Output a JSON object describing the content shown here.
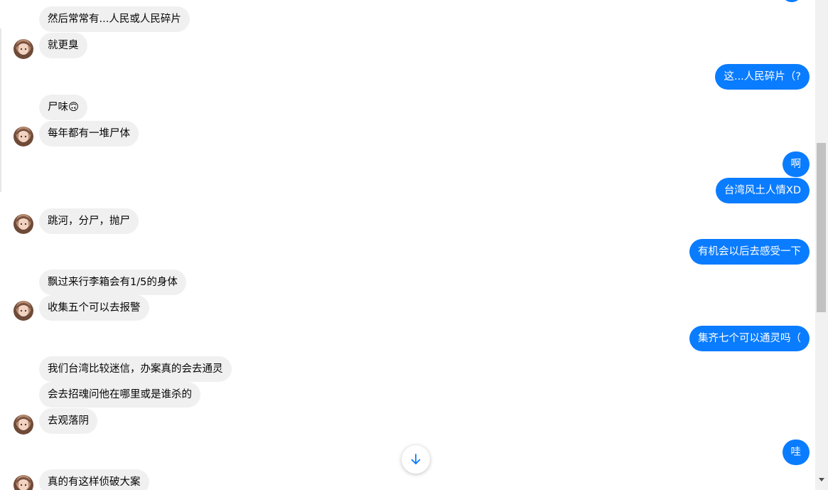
{
  "colors": {
    "outgoing_bubble": "#0a7cff",
    "incoming_bubble": "#f0f0f0",
    "accent_icon": "#0a7cff"
  },
  "messages": [
    {
      "side": "in",
      "text": "然后常常有...人民或人民碎片"
    },
    {
      "side": "in",
      "text": "就更臭",
      "avatar": true
    },
    {
      "side": "out",
      "text": "这...人民碎片（?"
    },
    {
      "side": "in",
      "text": "尸味🙃"
    },
    {
      "side": "in",
      "text": "每年都有一堆尸体",
      "avatar": true
    },
    {
      "side": "out",
      "text": "啊"
    },
    {
      "side": "out",
      "text": "台湾风土人情XD"
    },
    {
      "side": "in",
      "text": "跳河，分尸，抛尸",
      "avatar": true
    },
    {
      "side": "out",
      "text": "有机会以后去感受一下"
    },
    {
      "side": "in",
      "text": "飘过来行李箱会有1/5的身体"
    },
    {
      "side": "in",
      "text": "收集五个可以去报警",
      "avatar": true
    },
    {
      "side": "out",
      "text": "集齐七个可以通灵吗（"
    },
    {
      "side": "in",
      "text": "我们台湾比较迷信，办案真的会去通灵"
    },
    {
      "side": "in",
      "text": "会去招魂问他在哪里或是谁杀的"
    },
    {
      "side": "in",
      "text": "去观落阴",
      "avatar": true
    },
    {
      "side": "out",
      "text": "哇"
    },
    {
      "side": "in",
      "text": "真的有这样侦破大案",
      "avatar": true
    }
  ],
  "scroll_to_bottom_icon": "arrow-down-icon"
}
